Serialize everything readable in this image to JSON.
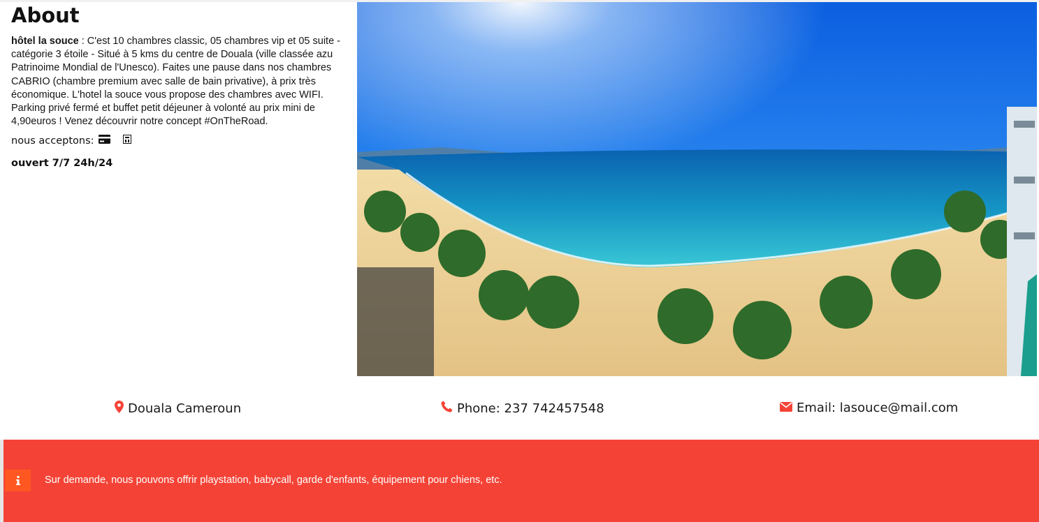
{
  "about": {
    "title": "About",
    "hotel_name": "hôtel la souce",
    "description": " : C'est 10 chambres classic, 05 chambres vip et 05 suite - catégorie 3 étoile - Situé à 5 kms du centre de Douala (ville classée azu Patrinoime Mondial de l'Unesco). Faites une pause dans nos chambres CABRIO (chambre premium avec salle de bain privative), à prix très économique. L'hotel la souce vous propose des chambres avec WIFI. Parking privé fermé et buffet petit déjeuner à volonté au prix mini de 4,90euros ! Venez découvrir notre concept #OnTheRoad.",
    "accept_label": "nous acceptons:",
    "accept_icons": [
      "credit-card-icon",
      "cash-icon"
    ],
    "hours": "ouvert 7/7 24h/24"
  },
  "contact": {
    "location": "Douala Cameroun",
    "phone": "Phone: 237 742457548",
    "email": "Email: lasouce@mail.com",
    "icons": [
      "map-marker-icon",
      "phone-icon",
      "envelope-icon"
    ],
    "icon_color": "#f44336"
  },
  "notice": {
    "text": "Sur demande, nous pouvons offrir playstation, babycall, garde d'enfants, équipement pour chiens, etc.",
    "background": "#f44336",
    "icon_background": "#ff5722",
    "icon": "info-icon"
  }
}
